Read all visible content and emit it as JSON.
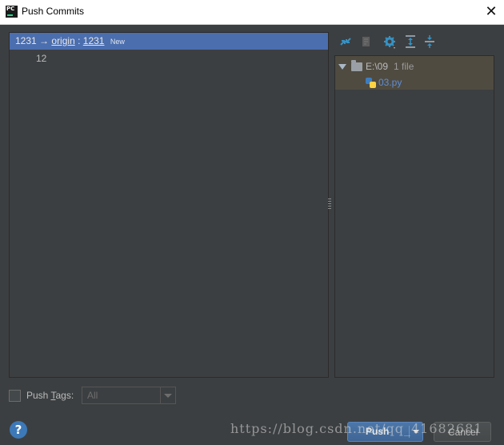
{
  "window": {
    "title": "Push Commits",
    "logo_text": "PC",
    "close_glyph": "✕"
  },
  "branch_row": {
    "local_branch": "1231",
    "arrow": "→",
    "remote": "origin",
    "separator": ":",
    "remote_branch": "1231",
    "badge": "New"
  },
  "commits": [
    {
      "message": "12"
    }
  ],
  "toolbar": {
    "icons": [
      "expand-diff-icon",
      "edit-source-icon",
      "settings-gear-icon",
      "expand-all-icon",
      "collapse-all-icon"
    ]
  },
  "changes_tree": {
    "directory": "E:\\09",
    "file_count": "1 file",
    "files": [
      {
        "name": "03.py",
        "icon": "python-file-icon"
      }
    ]
  },
  "footer": {
    "push_tags_prefix": "Push ",
    "push_tags_mnemonic": "T",
    "push_tags_suffix": "ags:",
    "tags_select_value": "All",
    "help_glyph": "?",
    "push_label": "Push",
    "cancel_label": "Cancel",
    "watermark": "https://blog.csdn.net/qq_41682681"
  },
  "colors": {
    "background": "#3c3f41",
    "selection": "#4b6eaf",
    "tree_highlight": "#4f4b41",
    "file_link": "#5f8dd3",
    "primary_button": "#3f6594"
  }
}
